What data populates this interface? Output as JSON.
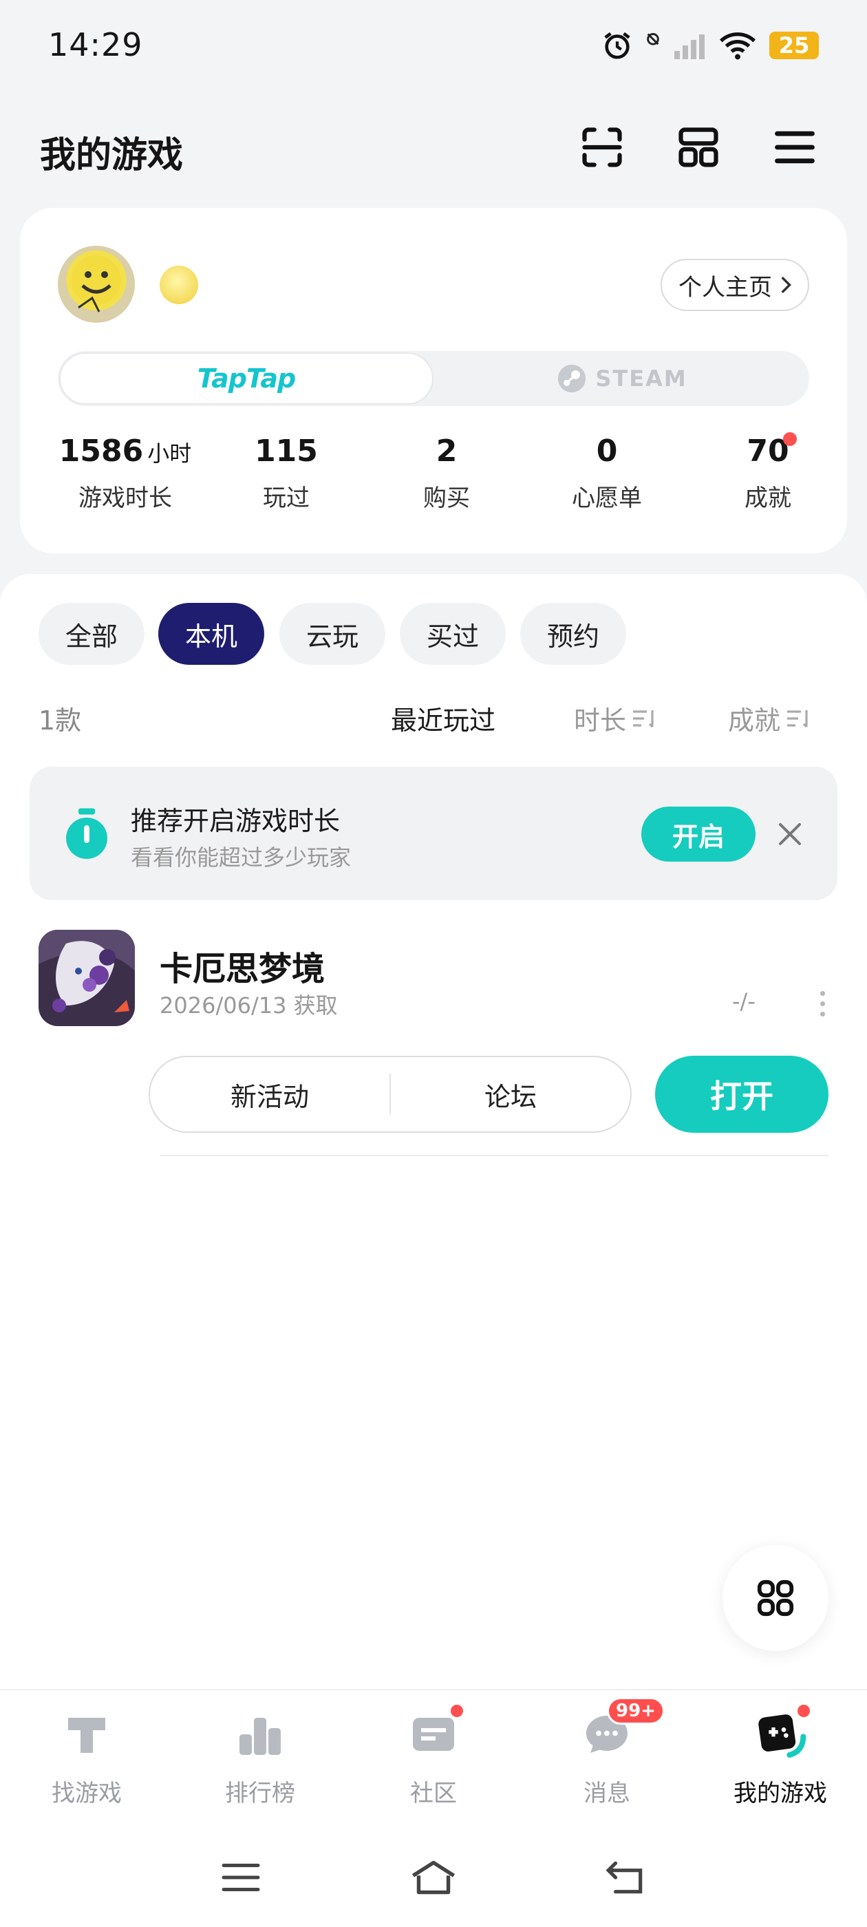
{
  "status_bar": {
    "time": "14:29",
    "battery": "25"
  },
  "header": {
    "title": "我的游戏",
    "icons": [
      "scan-icon",
      "layout-icon",
      "menu-icon"
    ]
  },
  "profile": {
    "home_button": "个人主页",
    "platforms": {
      "taptap": "TapTap",
      "steam": "STEAM"
    },
    "stats": [
      {
        "value": "1586",
        "unit": "小时",
        "label": "游戏时长"
      },
      {
        "value": "115",
        "label": "玩过"
      },
      {
        "value": "2",
        "label": "购买"
      },
      {
        "value": "0",
        "label": "心愿单"
      },
      {
        "value": "70",
        "label": "成就"
      }
    ]
  },
  "filters": {
    "chips": [
      "全部",
      "本机",
      "云玩",
      "买过",
      "预约"
    ],
    "active": "本机",
    "count": "1款",
    "sorts": [
      "最近玩过",
      "时长",
      "成就"
    ]
  },
  "promo": {
    "title": "推荐开启游戏时长",
    "subtitle": "看看你能超过多少玩家",
    "button": "开启"
  },
  "game": {
    "title": "卡厄思梦境",
    "date": "2026/06/13 获取",
    "playtime": "-/-",
    "actions": [
      "新活动",
      "论坛"
    ],
    "open": "打开"
  },
  "bottom_nav": {
    "items": [
      {
        "label": "找游戏"
      },
      {
        "label": "排行榜"
      },
      {
        "label": "社区"
      },
      {
        "label": "消息",
        "badge": "99+"
      },
      {
        "label": "我的游戏"
      }
    ],
    "active": "我的游戏"
  },
  "colors": {
    "accent": "#15ccbe",
    "active_chip": "#1f1d70",
    "badge": "#ff5050"
  }
}
